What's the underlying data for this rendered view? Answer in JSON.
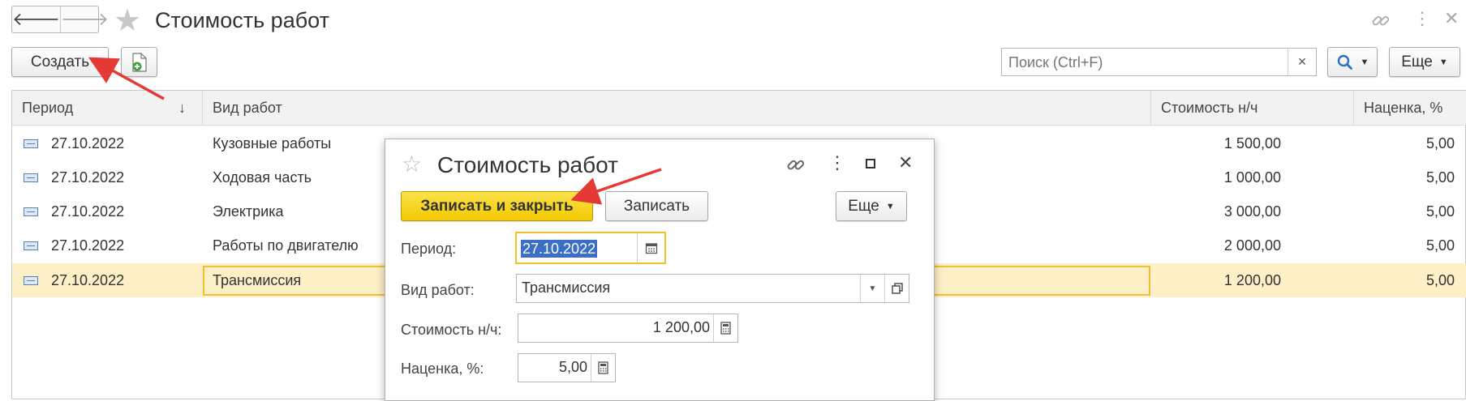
{
  "window": {
    "title": "Стоимость работ"
  },
  "nav": {
    "back": "🡐",
    "forward": "🡒"
  },
  "toolbar": {
    "create_label": "Создать",
    "search_placeholder": "Поиск (Ctrl+F)",
    "clear": "×",
    "more_label": "Еще"
  },
  "table": {
    "headers": [
      "Период",
      "Вид работ",
      "Стоимость н/ч",
      "Наценка, %"
    ],
    "sort_indicator": "↓",
    "rows": [
      {
        "period": "27.10.2022",
        "kind": "Кузовные работы",
        "cost": "1 500,00",
        "markup": "5,00"
      },
      {
        "period": "27.10.2022",
        "kind": "Ходовая часть",
        "cost": "1 000,00",
        "markup": "5,00"
      },
      {
        "period": "27.10.2022",
        "kind": "Электрика",
        "cost": "3 000,00",
        "markup": "5,00"
      },
      {
        "period": "27.10.2022",
        "kind": "Работы по двигателю",
        "cost": "2 000,00",
        "markup": "5,00"
      },
      {
        "period": "27.10.2022",
        "kind": "Трансмиссия",
        "cost": "1 200,00",
        "markup": "5,00"
      }
    ]
  },
  "dialog": {
    "title": "Стоимость работ",
    "save_close_label": "Записать и закрыть",
    "save_label": "Записать",
    "more_label": "Еще",
    "period_label": "Период:",
    "period_value": "27.10.2022",
    "kind_label": "Вид работ:",
    "kind_value": "Трансмиссия",
    "cost_label": "Стоимость н/ч:",
    "cost_value": "1 200,00",
    "markup_label": "Наценка, %:",
    "markup_value": "5,00"
  },
  "colors": {
    "accent_yellow": "#f5cf16",
    "selection": "#fdf0c6",
    "arrow": "#e53935"
  }
}
